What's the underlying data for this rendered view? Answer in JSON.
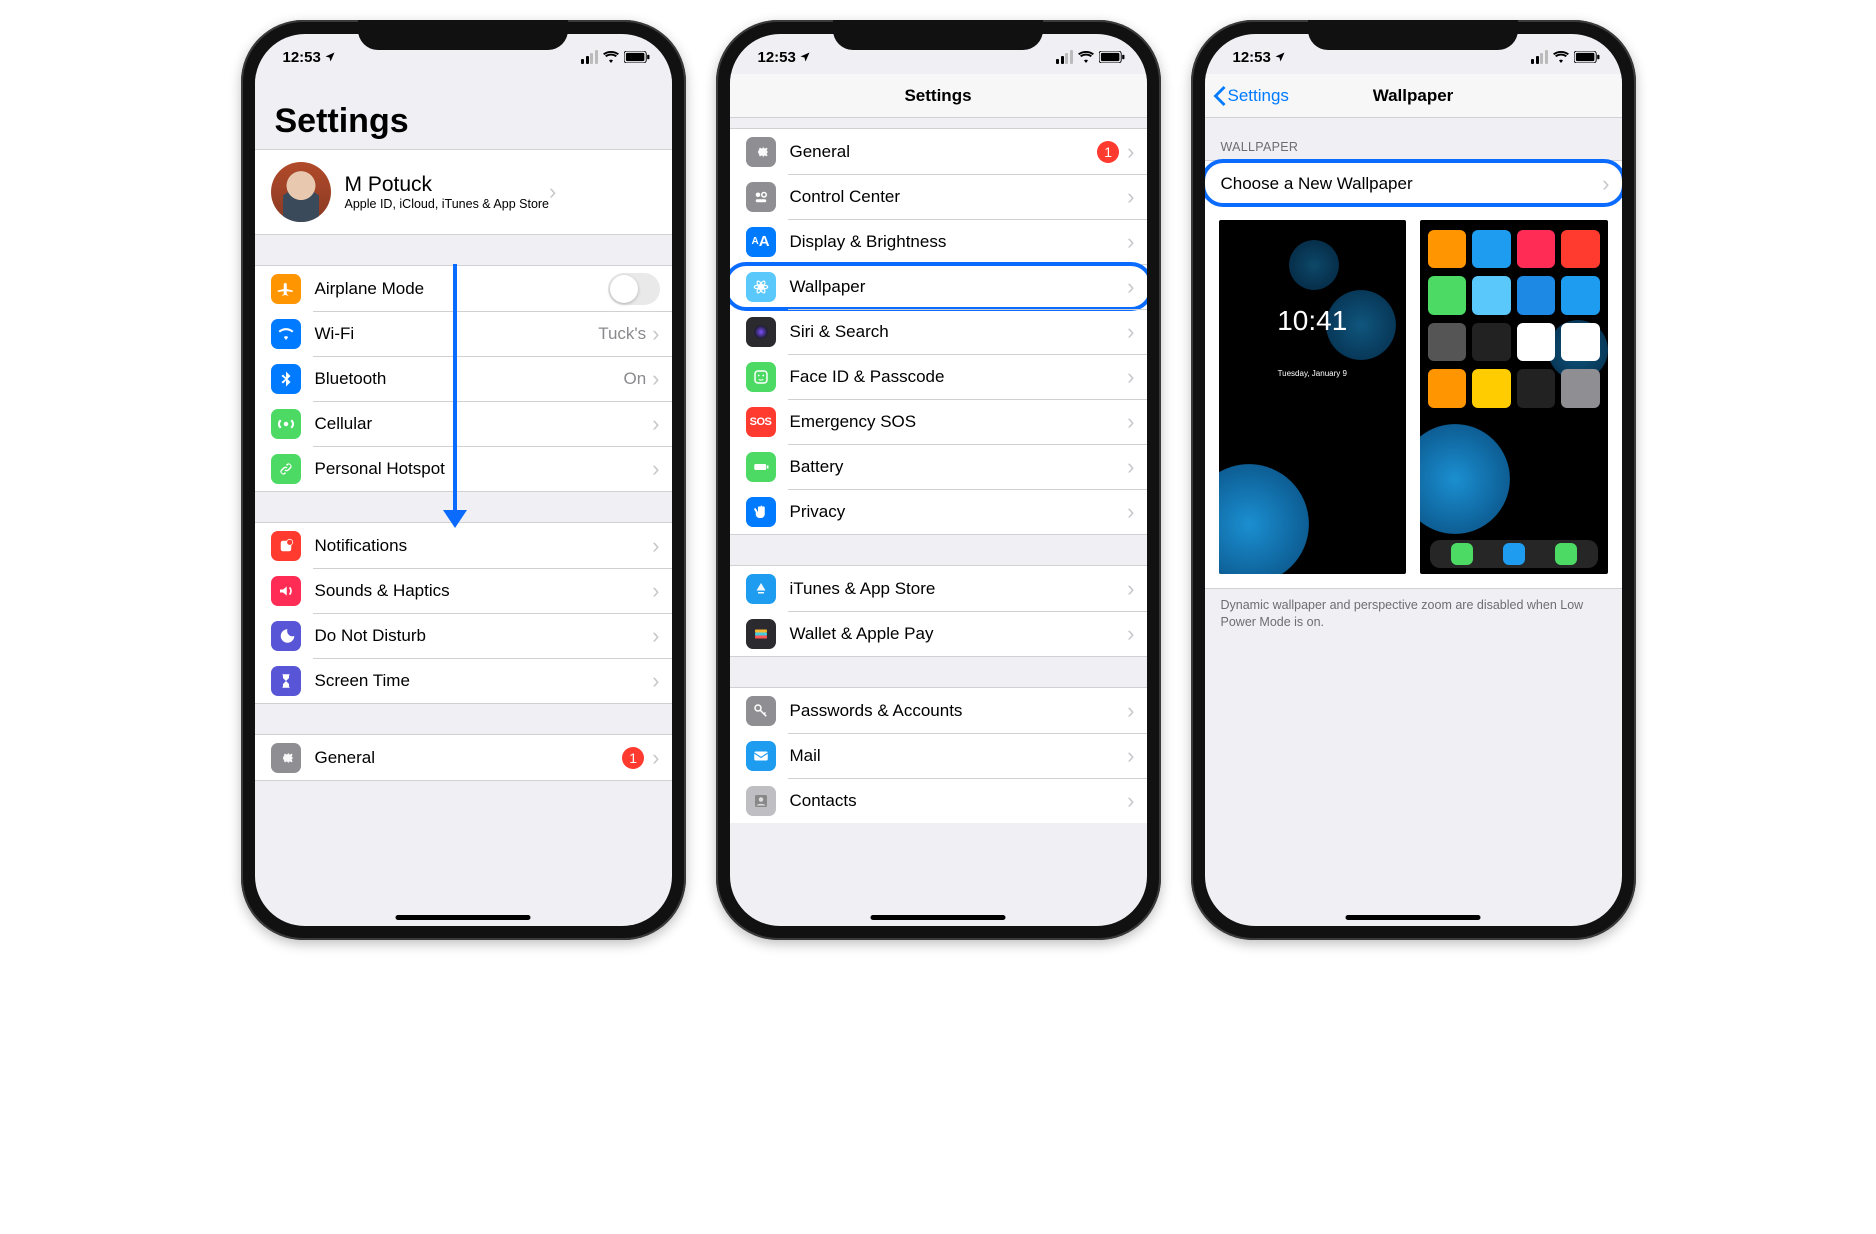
{
  "status": {
    "time": "12:53",
    "location_icon": "loc"
  },
  "colors": {
    "blue": "#007aff",
    "orange": "#ff9500",
    "green": "#4cd964",
    "red": "#ff3b30",
    "purple": "#5856d6",
    "gray": "#8e8e93",
    "teal": "#5ac8fa",
    "darkblue": "#0a60ff",
    "pink": "#ff2d55",
    "cyan": "#32ade6"
  },
  "phone1": {
    "title": "Settings",
    "profile": {
      "name": "M Potuck",
      "subtitle": "Apple ID, iCloud, iTunes & App Store"
    },
    "groupA": [
      {
        "label": "Airplane Mode",
        "icon": "plane",
        "color": "#ff9500",
        "type": "toggle"
      },
      {
        "label": "Wi-Fi",
        "icon": "wifi",
        "color": "#007aff",
        "value": "Tuck's"
      },
      {
        "label": "Bluetooth",
        "icon": "bt",
        "color": "#007aff",
        "value": "On"
      },
      {
        "label": "Cellular",
        "icon": "cell",
        "color": "#4cd964"
      },
      {
        "label": "Personal Hotspot",
        "icon": "link",
        "color": "#4cd964"
      }
    ],
    "groupB": [
      {
        "label": "Notifications",
        "icon": "notif",
        "color": "#ff3b30"
      },
      {
        "label": "Sounds & Haptics",
        "icon": "sound",
        "color": "#ff2d55"
      },
      {
        "label": "Do Not Disturb",
        "icon": "moon",
        "color": "#5856d6"
      },
      {
        "label": "Screen Time",
        "icon": "hour",
        "color": "#5856d6"
      }
    ],
    "groupC": [
      {
        "label": "General",
        "icon": "gear",
        "color": "#8e8e93",
        "badge": "1"
      }
    ]
  },
  "phone2": {
    "title": "Settings",
    "groupA": [
      {
        "label": "General",
        "icon": "gear",
        "color": "#8e8e93",
        "badge": "1"
      },
      {
        "label": "Control Center",
        "icon": "cc",
        "color": "#8e8e93"
      },
      {
        "label": "Display & Brightness",
        "icon": "aa",
        "color": "#007aff"
      },
      {
        "label": "Wallpaper",
        "icon": "flower",
        "color": "#5ac8fa",
        "highlighted": true
      },
      {
        "label": "Siri & Search",
        "icon": "siri",
        "color": "#2b2b2f"
      },
      {
        "label": "Face ID & Passcode",
        "icon": "face",
        "color": "#4cd964"
      },
      {
        "label": "Emergency SOS",
        "icon": "sos",
        "color": "#ff3b30"
      },
      {
        "label": "Battery",
        "icon": "batt",
        "color": "#4cd964"
      },
      {
        "label": "Privacy",
        "icon": "hand",
        "color": "#007aff"
      }
    ],
    "groupB": [
      {
        "label": "iTunes & App Store",
        "icon": "appstore",
        "color": "#1e9cf0"
      },
      {
        "label": "Wallet & Apple Pay",
        "icon": "wallet",
        "color": "#2b2b2f"
      }
    ],
    "groupC": [
      {
        "label": "Passwords & Accounts",
        "icon": "key",
        "color": "#8e8e93"
      },
      {
        "label": "Mail",
        "icon": "mail",
        "color": "#1e9cf0"
      },
      {
        "label": "Contacts",
        "icon": "contacts",
        "color": "#bfbfc3"
      }
    ]
  },
  "phone3": {
    "back": "Settings",
    "title": "Wallpaper",
    "section_header": "WALLPAPER",
    "choose": "Choose a New Wallpaper",
    "lock_time": "10:41",
    "lock_date": "Tuesday, January 9",
    "note": "Dynamic wallpaper and perspective zoom are disabled when Low Power Mode is on."
  }
}
